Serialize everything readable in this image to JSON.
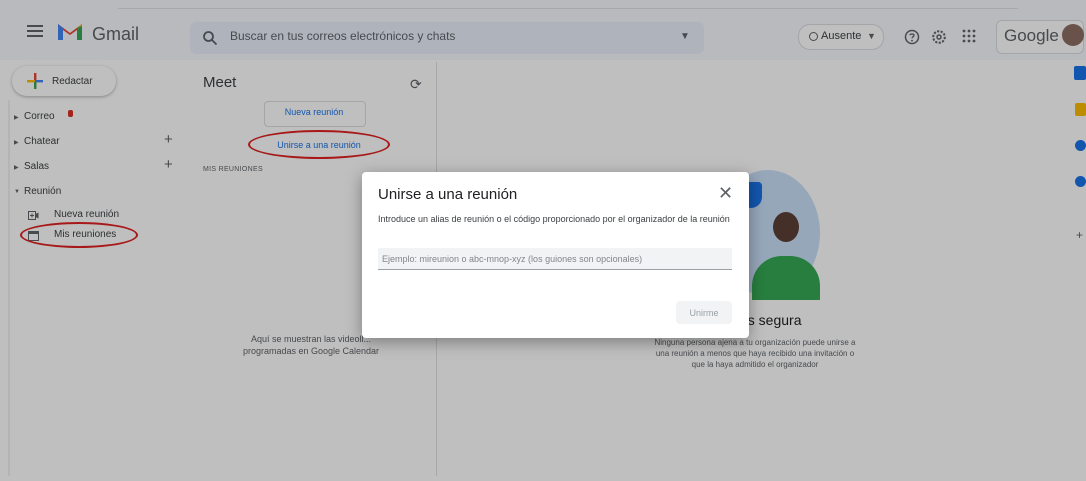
{
  "app": {
    "name": "Gmail",
    "search_placeholder": "Buscar en tus correos electrónicos y chats",
    "status": "Ausente",
    "brand": "Google"
  },
  "sidebar": {
    "compose": "Redactar",
    "items": [
      {
        "label": "Correo"
      },
      {
        "label": "Chatear"
      },
      {
        "label": "Salas"
      },
      {
        "label": "Reunión"
      }
    ],
    "sub_items": [
      {
        "label": "Nueva reunión"
      },
      {
        "label": "Mis reuniones"
      }
    ]
  },
  "meet": {
    "title": "Meet",
    "new_meeting": "Nueva reunión",
    "join_meeting": "Unirse a una reunión",
    "section": "MIS REUNIONES",
    "empty_line1": "Aquí se muestran las videoll...",
    "empty_line2": "programadas en Google Calendar"
  },
  "illustration": {
    "title": "es segura",
    "body": "Ninguna persona ajena a tu organización puede unirse a una reunión a menos que haya recibido una invitación o que la haya admitido el organizador"
  },
  "dialog": {
    "title": "Unirse a una reunión",
    "description": "Introduce un alias de reunión o el código proporcionado por el organizador de la reunión",
    "placeholder": "Ejemplo: mireunion o abc-mnop-xyz (los guiones son opcionales)",
    "submit": "Unirme"
  },
  "colors": {
    "accent": "#1a73e8",
    "highlight_ring": "#e02020",
    "gmail_red": "#ea4335"
  }
}
